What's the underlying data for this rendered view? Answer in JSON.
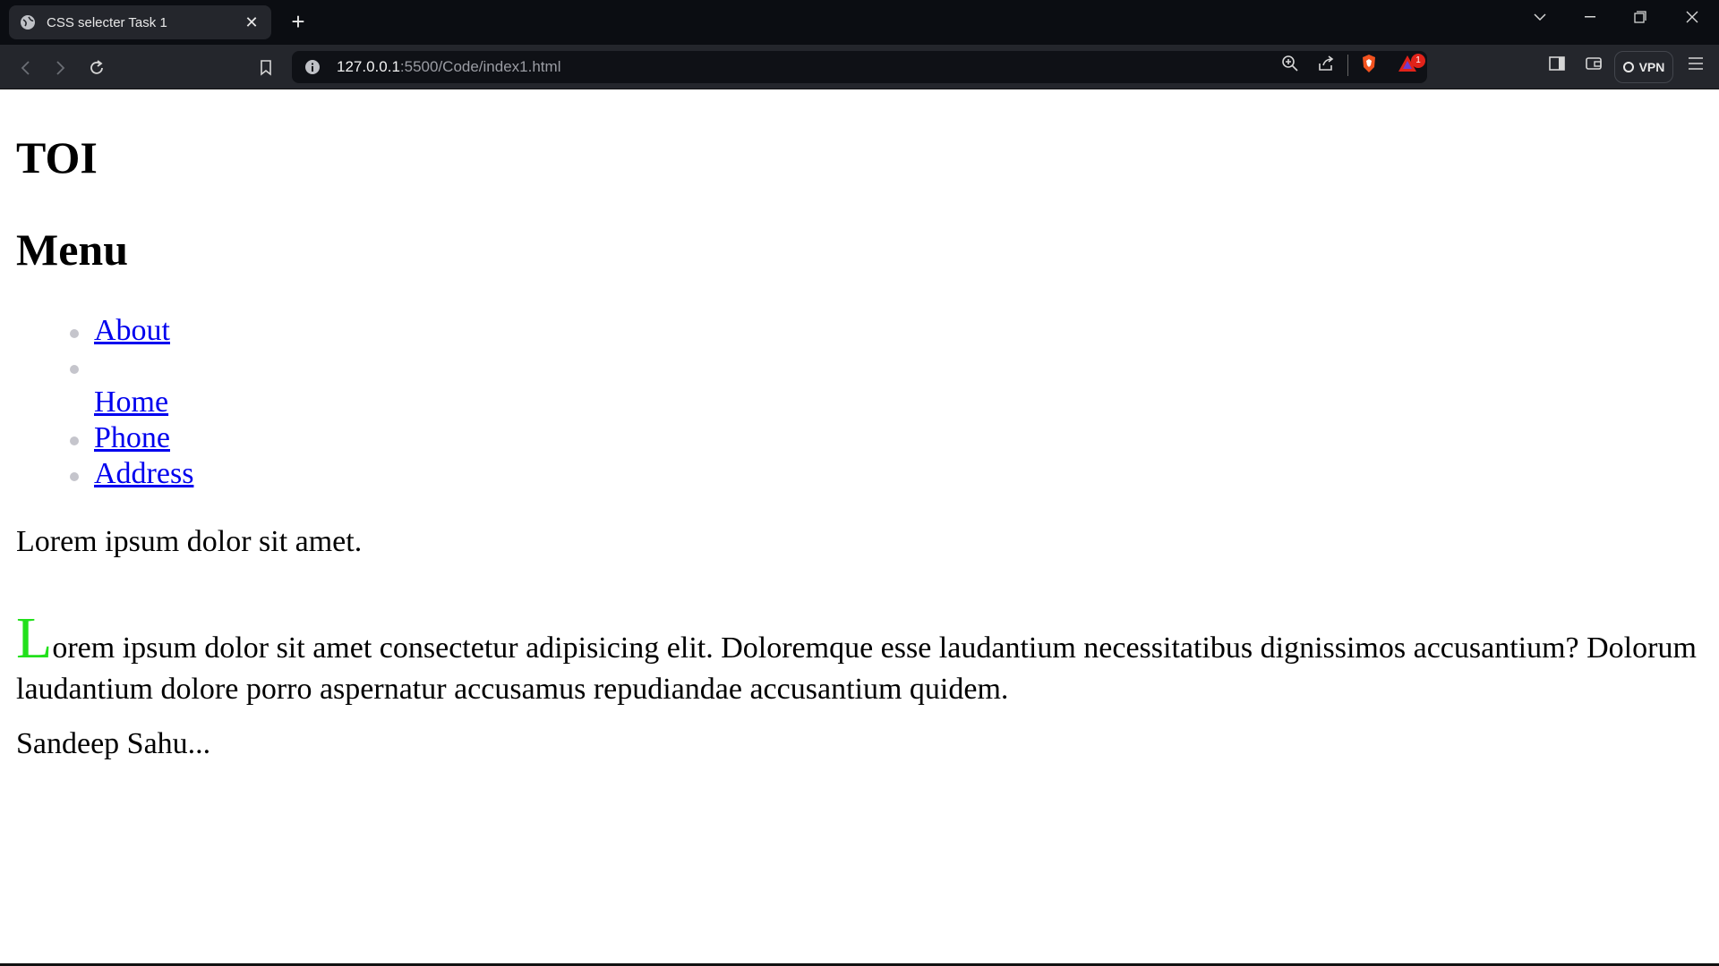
{
  "browser": {
    "tab_title": "CSS selecter Task 1",
    "new_tab_label": "+",
    "url_host": "127.0.0.1",
    "url_path": ":5500/Code/index1.html",
    "notification_count": "1",
    "vpn_label": "VPN"
  },
  "page": {
    "heading_1": "TOI",
    "heading_2": "Menu",
    "menu_items": [
      {
        "label": "About"
      },
      {
        "label": ""
      },
      {
        "label": "Home"
      },
      {
        "label": "Phone"
      },
      {
        "label": "Address"
      }
    ],
    "paragraph_1": "Lorem ipsum dolor sit amet.",
    "paragraph_2_dropcap": "L",
    "paragraph_2_rest": "orem ipsum dolor sit amet consectetur adipisicing elit. Doloremque esse laudantium necessitatibus dignissimos accusantium? Dolorum laudantium dolore porro aspernatur accusamus repudiandae accusantium quidem.",
    "paragraph_3": "Sandeep Sahu...",
    "dropcap_color": "#22e01b",
    "link_color": "#0000ee"
  }
}
